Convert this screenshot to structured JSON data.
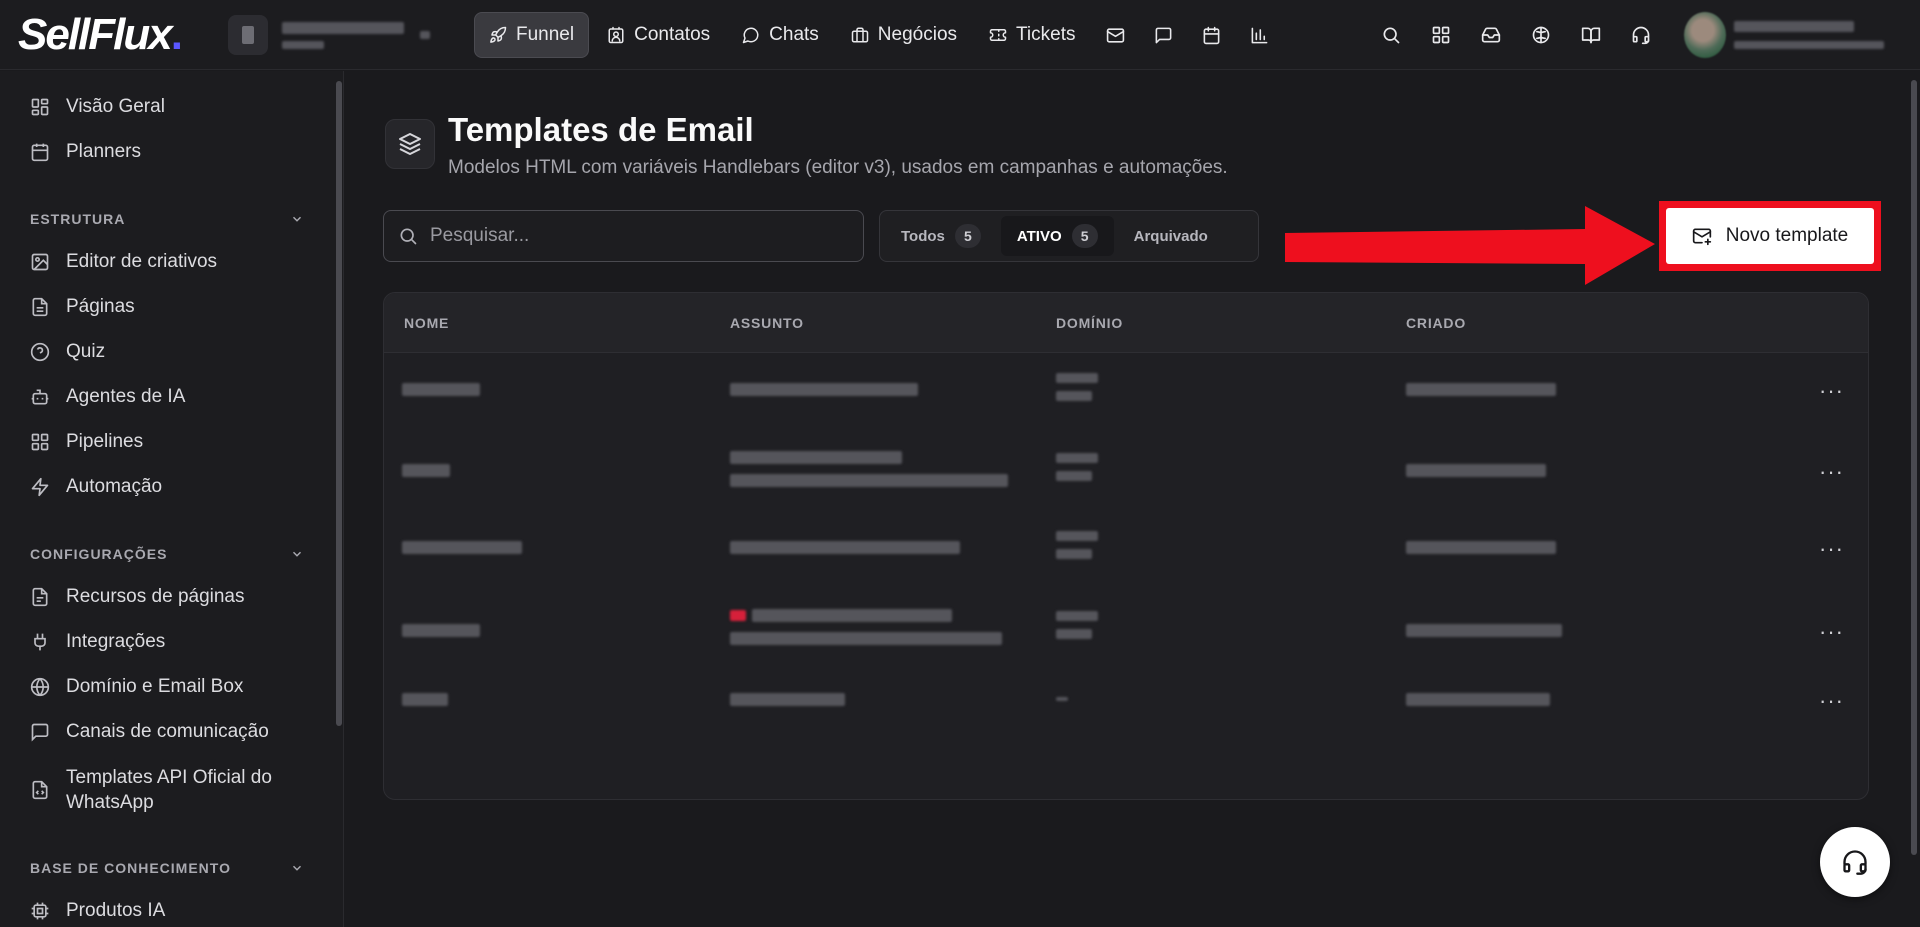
{
  "brand": {
    "logo_text": "SellFlux",
    "logo_dot": ".",
    "accent": "#5b57ff"
  },
  "nav": {
    "items": [
      {
        "label": "Funnel",
        "icon": "rocket-icon"
      },
      {
        "label": "Contatos",
        "icon": "contacts-icon"
      },
      {
        "label": "Chats",
        "icon": "chat-bubble-icon"
      },
      {
        "label": "Negócios",
        "icon": "briefcase-icon"
      },
      {
        "label": "Tickets",
        "icon": "ticket-icon"
      }
    ],
    "active": "Funnel",
    "extra_icons": [
      "mail-icon",
      "message-square-icon",
      "calendar-icon",
      "bar-chart-icon"
    ]
  },
  "topbar_right_icons": [
    "search-icon",
    "apps-grid-icon",
    "inbox-icon",
    "brain-icon",
    "book-icon",
    "headset-icon"
  ],
  "sidebar": {
    "top_items": [
      {
        "label": "Visão Geral",
        "icon": "dashboard-icon"
      },
      {
        "label": "Planners",
        "icon": "calendar-icon"
      }
    ],
    "sections": [
      {
        "title": "ESTRUTURA",
        "items": [
          {
            "label": "Editor de criativos",
            "icon": "image-edit-icon"
          },
          {
            "label": "Páginas",
            "icon": "file-icon"
          },
          {
            "label": "Quiz",
            "icon": "help-circle-icon"
          },
          {
            "label": "Agentes de IA",
            "icon": "bot-icon"
          },
          {
            "label": "Pipelines",
            "icon": "grid-icon"
          },
          {
            "label": "Automação",
            "icon": "zap-icon"
          }
        ]
      },
      {
        "title": "CONFIGURAÇÕES",
        "items": [
          {
            "label": "Recursos de páginas",
            "icon": "file-text-icon"
          },
          {
            "label": "Integrações",
            "icon": "plug-icon"
          },
          {
            "label": "Domínio e Email Box",
            "icon": "globe-icon"
          },
          {
            "label": "Canais de comunicação",
            "icon": "message-square-icon"
          },
          {
            "label": "Templates API Oficial do",
            "label2": "WhatsApp",
            "icon": "file-code-icon"
          }
        ]
      },
      {
        "title": "BASE DE CONHECIMENTO",
        "items": [
          {
            "label": "Produtos IA",
            "icon": "cpu-icon"
          }
        ]
      }
    ]
  },
  "page": {
    "title": "Templates de Email",
    "subtitle": "Modelos HTML com variáveis Handlebars (editor v3), usados em campanhas e automações.",
    "icon": "layers-icon"
  },
  "search": {
    "placeholder": "Pesquisar...",
    "value": ""
  },
  "filters": [
    {
      "label": "Todos",
      "count": "5",
      "active": false
    },
    {
      "label": "ATIVO",
      "count": "5",
      "active": true
    },
    {
      "label": "Arquivado",
      "count": "",
      "active": false
    }
  ],
  "new_button": {
    "label": "Novo template",
    "icon": "mail-plus-icon",
    "highlight_color": "#ee0f1e"
  },
  "table": {
    "columns": [
      "NOME",
      "ASSUNTO",
      "DOMÍNIO",
      "CRIADO"
    ],
    "rows": [
      {
        "actions": "···"
      },
      {
        "actions": "···"
      },
      {
        "actions": "···"
      },
      {
        "actions": "···"
      },
      {
        "actions": "···"
      }
    ]
  },
  "help_button": {
    "icon": "headset-icon"
  }
}
